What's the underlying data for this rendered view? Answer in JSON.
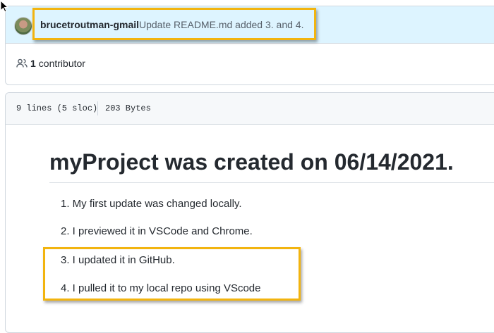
{
  "commit": {
    "author": "brucetroutman-gmail",
    "message": "Update README.md added 3. and 4."
  },
  "contributors": {
    "count": "1",
    "label": "contributor"
  },
  "file": {
    "lines": "9 lines (5 sloc)",
    "size": "203 Bytes"
  },
  "readme": {
    "title": "myProject was created on 06/14/2021.",
    "items": [
      "1. My first update was changed locally.",
      "2. I previewed it in VSCode and Chrome.",
      "3. I updated it in GitHub.",
      "4. I pulled it to my local repo using VScode"
    ]
  },
  "colors": {
    "highlight": "#f2b40f",
    "commit_bg": "#ddf4ff"
  },
  "icons": [
    "mouse-cursor-icon",
    "people-icon"
  ]
}
